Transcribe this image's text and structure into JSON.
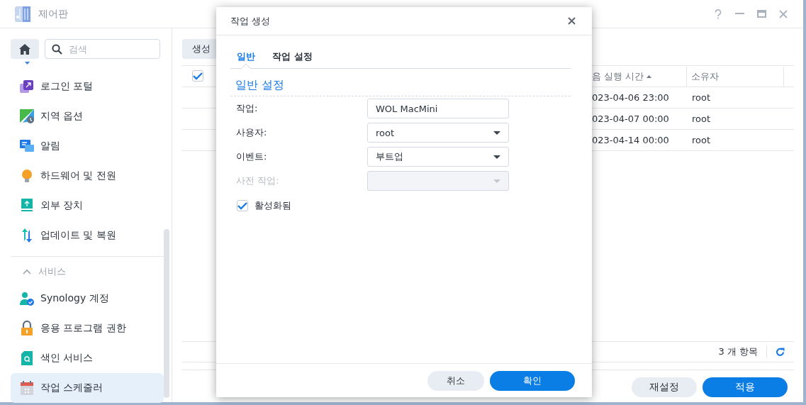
{
  "window": {
    "title": "제어판"
  },
  "sidebar": {
    "search": {
      "placeholder": "검색"
    },
    "groups": [
      {
        "items": [
          {
            "label": "로그인 포털",
            "selected": false
          },
          {
            "label": "지역 옵션",
            "selected": false
          },
          {
            "label": "알림",
            "selected": false
          },
          {
            "label": "하드웨어 및 전원",
            "selected": false
          },
          {
            "label": "외부 장치",
            "selected": false
          },
          {
            "label": "업데이트 및 복원",
            "selected": false
          }
        ]
      },
      {
        "title": "서비스",
        "expanded": true,
        "items": [
          {
            "label": "Synology 계정",
            "selected": false
          },
          {
            "label": "응용 프로그램 권한",
            "selected": false
          },
          {
            "label": "색인 서비스",
            "selected": false
          },
          {
            "label": "작업 스케줄러",
            "selected": true
          }
        ]
      }
    ]
  },
  "toolbar": {
    "create_button": "생성"
  },
  "table": {
    "header_checkbox": {
      "checked": true
    },
    "columns": [
      {
        "label": "음 실행 시간",
        "sorted": true
      },
      {
        "label": "소유자",
        "sorted": false
      }
    ],
    "rows": [
      {
        "next_run": "023-04-06 23:00",
        "owner": "root"
      },
      {
        "next_run": "023-04-07 00:00",
        "owner": "root"
      },
      {
        "next_run": "023-04-14 00:00",
        "owner": "root"
      }
    ],
    "count": "3 개 항목"
  },
  "buttons": [
    {
      "label": "재설정",
      "kind": "secondary"
    },
    {
      "label": "적용",
      "kind": "primary"
    }
  ],
  "dialog": {
    "title": "작업 생성",
    "tabs": [
      {
        "label": "일반",
        "selected": true
      },
      {
        "label": "작업 설정",
        "selected": false
      }
    ],
    "section_title": "일반 설정",
    "fields": [
      {
        "label": "작업:",
        "kind": "text",
        "value": "WOL MacMini",
        "disabled": false
      },
      {
        "label": "사용자:",
        "kind": "select",
        "value": "root",
        "disabled": false
      },
      {
        "label": "이벤트:",
        "kind": "select",
        "value": "부트업",
        "disabled": false
      },
      {
        "label": "사전 작업:",
        "kind": "select",
        "disabled": true
      }
    ],
    "checkbox": {
      "label": "활성화됨",
      "checked": true
    },
    "buttons": [
      {
        "label": "취소",
        "kind": "secondary"
      },
      {
        "label": "확인",
        "kind": "primary"
      }
    ]
  }
}
